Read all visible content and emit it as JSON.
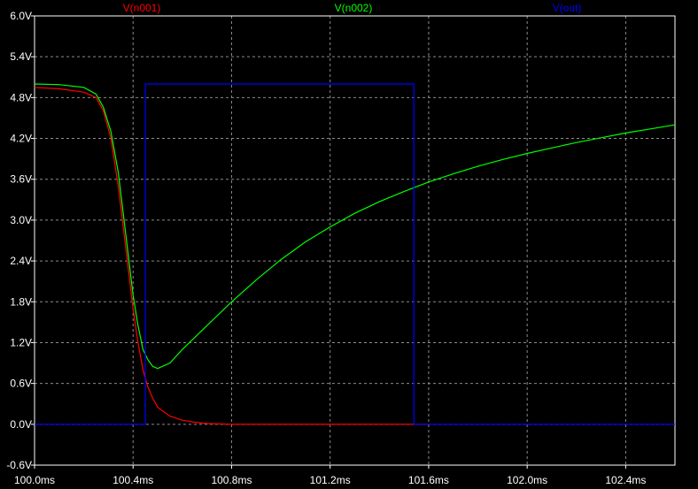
{
  "chart_data": {
    "type": "line",
    "title": "",
    "xlabel": "",
    "ylabel": "",
    "xlim": [
      100.0,
      102.6
    ],
    "ylim": [
      -0.6,
      6.0
    ],
    "grid": true,
    "x_ticks": [
      {
        "value": 100.0,
        "label": "100.0ms"
      },
      {
        "value": 100.4,
        "label": "100.4ms"
      },
      {
        "value": 100.8,
        "label": "100.8ms"
      },
      {
        "value": 101.2,
        "label": "101.2ms"
      },
      {
        "value": 101.6,
        "label": "101.6ms"
      },
      {
        "value": 102.0,
        "label": "102.0ms"
      },
      {
        "value": 102.4,
        "label": "102.4ms"
      }
    ],
    "y_ticks": [
      {
        "value": 6.0,
        "label": "6.0V"
      },
      {
        "value": 5.4,
        "label": "5.4V"
      },
      {
        "value": 4.8,
        "label": "4.8V"
      },
      {
        "value": 4.2,
        "label": "4.2V"
      },
      {
        "value": 3.6,
        "label": "3.6V"
      },
      {
        "value": 3.0,
        "label": "3.0V"
      },
      {
        "value": 2.4,
        "label": "2.4V"
      },
      {
        "value": 1.8,
        "label": "1.8V"
      },
      {
        "value": 1.2,
        "label": "1.2V"
      },
      {
        "value": 0.6,
        "label": "0.6V"
      },
      {
        "value": 0.0,
        "label": "0.0V"
      },
      {
        "value": -0.6,
        "label": "-0.6V"
      }
    ],
    "series": [
      {
        "name": "V(n001)",
        "color": "#ff0000",
        "x": [
          100.0,
          100.1,
          100.2,
          100.25,
          100.28,
          100.31,
          100.34,
          100.37,
          100.4,
          100.42,
          100.44,
          100.46,
          100.48,
          100.5,
          100.55,
          100.6,
          100.65,
          100.7,
          100.8,
          101.0,
          101.2,
          101.4,
          101.6
        ],
        "y": [
          4.95,
          4.93,
          4.88,
          4.8,
          4.6,
          4.2,
          3.5,
          2.6,
          1.7,
          1.2,
          0.8,
          0.55,
          0.38,
          0.25,
          0.12,
          0.06,
          0.03,
          0.01,
          0.0,
          0.0,
          0.0,
          0.0,
          0.0
        ]
      },
      {
        "name": "V(n002)",
        "color": "#00ff00",
        "x": [
          100.0,
          100.1,
          100.2,
          100.25,
          100.28,
          100.31,
          100.34,
          100.37,
          100.4,
          100.42,
          100.44,
          100.46,
          100.48,
          100.5,
          100.55,
          100.6,
          100.7,
          100.8,
          100.9,
          101.0,
          101.1,
          101.2,
          101.3,
          101.4,
          101.5,
          101.6,
          101.7,
          101.8,
          101.9,
          102.0,
          102.1,
          102.2,
          102.3,
          102.4,
          102.5,
          102.6
        ],
        "y": [
          5.0,
          4.99,
          4.95,
          4.85,
          4.65,
          4.3,
          3.7,
          2.8,
          1.9,
          1.45,
          1.1,
          0.95,
          0.85,
          0.82,
          0.9,
          1.1,
          1.45,
          1.8,
          2.12,
          2.42,
          2.68,
          2.9,
          3.1,
          3.27,
          3.42,
          3.56,
          3.68,
          3.79,
          3.89,
          3.98,
          4.06,
          4.14,
          4.21,
          4.28,
          4.34,
          4.4
        ]
      },
      {
        "name": "V(out)",
        "color": "#0000ff",
        "x": [
          100.0,
          100.45,
          100.45,
          101.54,
          101.54,
          102.6
        ],
        "y": [
          0.0,
          0.0,
          5.0,
          5.0,
          0.0,
          0.0
        ]
      }
    ]
  }
}
